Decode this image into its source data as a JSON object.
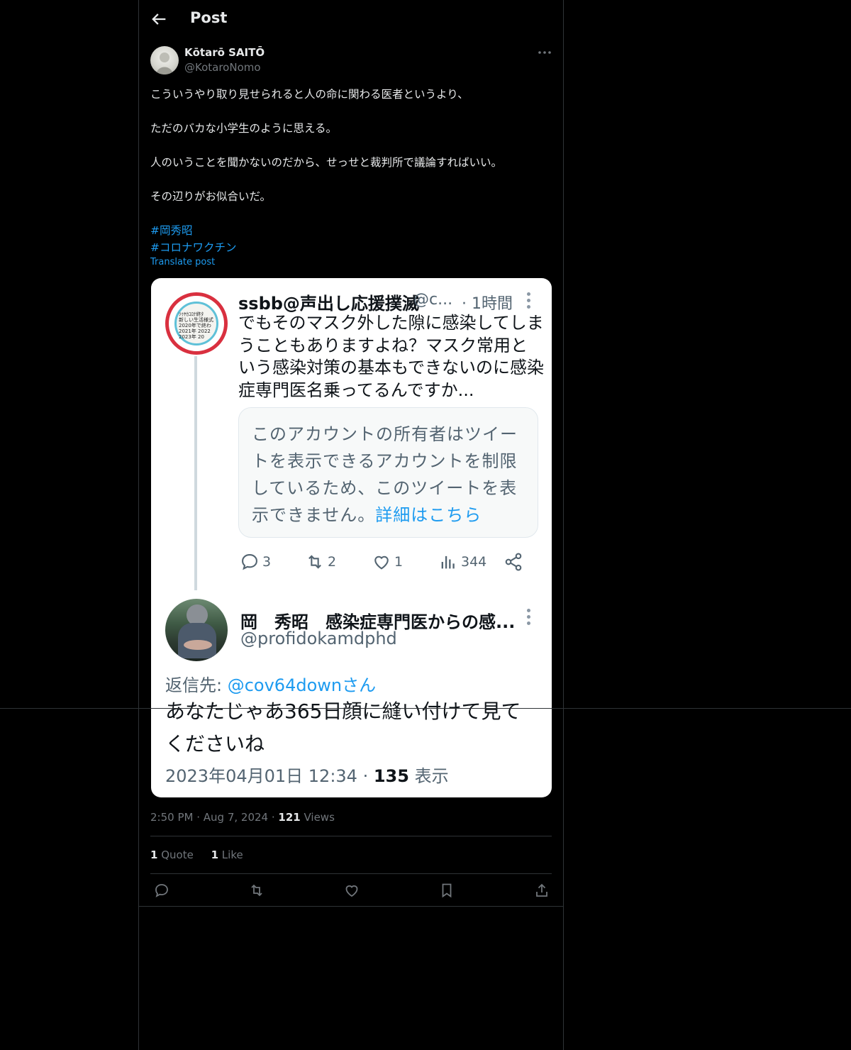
{
  "topbar": {
    "title": "Post"
  },
  "author": {
    "name": "Kōtarō SAITŌ",
    "handle": "@KotaroNomo"
  },
  "tweet": {
    "lines": [
      "こういうやり取り見せられると人の命に関わる医者というより、",
      "ただのバカな小学生のように思える。",
      "人のいうことを聞かないのだから、せっせと裁判所で議論すればいい。",
      "その辺りがお似合いだ。"
    ],
    "hashtags": [
      "#岡秀昭",
      "#コロナワクチン"
    ],
    "translate_label": "Translate post"
  },
  "embedded": {
    "tweet1": {
      "name": "ssbb@声出し応援撲滅",
      "handle": "@c...",
      "time": "· 1時間",
      "avatar_text": [
        "ｿｩﾔｶｺﾛﾅ終ﾀ",
        "新しい生活様式",
        "2020年で終わ",
        "2021年 2022",
        "2023年 20"
      ],
      "body_lines": [
        "でもそのマスク外した隙に感染してしま",
        "うこともありますよね？マスク常用と",
        "いう感染対策の基本もできないのに感染",
        "症専門医名乗ってるんですか..."
      ],
      "restricted_lines": [
        "このアカウントの所有者はツイー",
        "トを表示できるアカウントを制限",
        "しているため、このツイートを表"
      ],
      "restricted_last": "示できません。",
      "restricted_link": "詳細はこちら",
      "actions": {
        "replies": "3",
        "retweets": "2",
        "likes": "1",
        "views": "344"
      }
    },
    "tweet2": {
      "name": "岡　秀昭　感染症専門医からの感...",
      "handle": "@profidokamdphd",
      "reply_prefix": "返信先: ",
      "reply_mention": "@cov64downさん",
      "body_lines": [
        "あなたじゃあ365日顔に縫い付けて見て",
        "くださいね"
      ],
      "date": "2023年04月01日 12:34 · ",
      "views_count": "135",
      "views_label": " 表示"
    }
  },
  "post_meta": {
    "time": "2:50 PM",
    "sep": " · ",
    "date": "Aug 7, 2024",
    "sep2": " · ",
    "views_count": "121",
    "views_label": " Views"
  },
  "stats": {
    "quotes_count": "1",
    "quotes_label": " Quote",
    "likes_count": "1",
    "likes_label": " Like"
  },
  "colors": {
    "background": "#000000",
    "accent": "#1d9bf0",
    "border": "#2f3336",
    "muted": "#71767b"
  },
  "icons": [
    "back-arrow-icon",
    "more-icon",
    "reply-icon",
    "retweet-icon",
    "like-icon",
    "bookmark-icon",
    "share-icon",
    "views-icon"
  ]
}
